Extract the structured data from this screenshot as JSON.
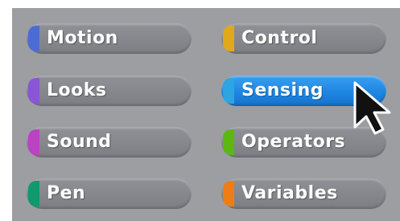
{
  "palette": {
    "categories": [
      {
        "label": "Motion",
        "color": "#4a6cd4",
        "selected": false
      },
      {
        "label": "Looks",
        "color": "#8a55d7",
        "selected": false
      },
      {
        "label": "Sound",
        "color": "#bb42c3",
        "selected": false
      },
      {
        "label": "Pen",
        "color": "#0e9a6c",
        "selected": false
      },
      {
        "label": "Control",
        "color": "#e1a91a",
        "selected": false
      },
      {
        "label": "Sensing",
        "color": "#2ca5e2",
        "selected": true
      },
      {
        "label": "Operators",
        "color": "#5cb712",
        "selected": false
      },
      {
        "label": "Variables",
        "color": "#ee7d16",
        "selected": false
      }
    ]
  },
  "cursor": {
    "icon": "arrow-cursor-icon"
  }
}
